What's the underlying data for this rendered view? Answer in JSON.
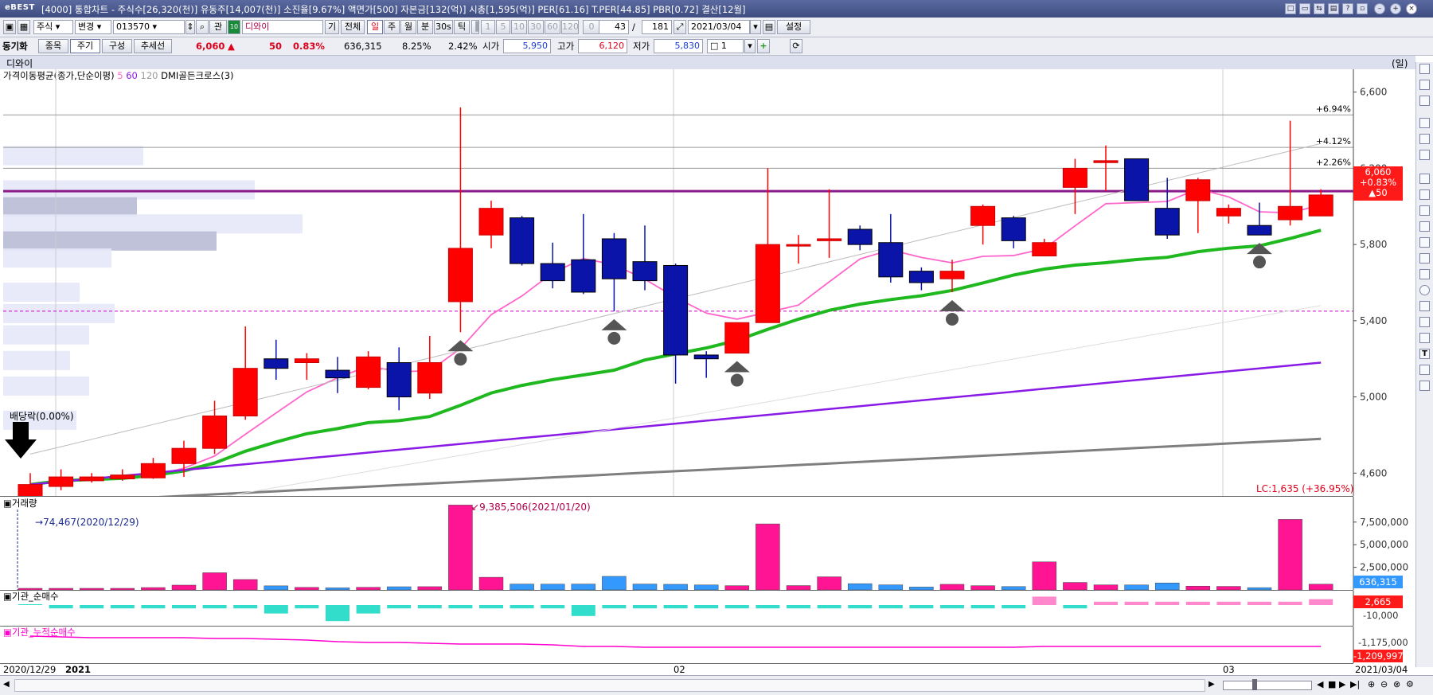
{
  "window": {
    "logo": "eBEST",
    "title": "[4000] 통합차트 - 주식수[26,320(천)] 유동주[14,007(천)] 소진율[9.67%] 액면가[500] 자본금[132(억)] 시총[1,595(억)] PER[61.16] T.PER[44.85] PBR[0.72] 결산[12월]"
  },
  "toolbar1": {
    "market": "주식",
    "change": "변경",
    "code": "013570",
    "related": "관",
    "badge": "10",
    "name": "디와이",
    "gi": "기",
    "all": "전체",
    "periods": [
      "일",
      "주",
      "월",
      "분",
      "30s",
      "틱"
    ],
    "minutes": [
      "1",
      "5",
      "10",
      "30",
      "60",
      "120"
    ],
    "zero": "0",
    "count": "43",
    "slash": "/",
    "total": "181",
    "date": "2021/03/04",
    "settings": "설정"
  },
  "toolbar2": {
    "sync": "동기화",
    "tabs": [
      "종목",
      "주기",
      "구성",
      "추세선"
    ],
    "price": "6,060",
    "arrow": "▲",
    "change": "50",
    "change_pct": "0.83%",
    "volume": "636,315",
    "turnover": "8.25%",
    "ratio": "2.42%",
    "open_label": "시가",
    "open": "5,950",
    "high_label": "고가",
    "high": "6,120",
    "low_label": "저가",
    "low": "5,830",
    "qty": "1"
  },
  "chart": {
    "stock_name": "디와이",
    "unit": "(일)",
    "legend": {
      "ma_label": "가격이동평균(종가,단순이평)",
      "ma5": "5",
      "ma60": "60",
      "ma120": "120",
      "dmi": "DMI골든크로스(3)"
    },
    "dividend_label": "배당락(0.00%)",
    "lc_label": "LC:1,635 (+36.95%)",
    "current_price_tag": {
      "price": "6,060",
      "pct": "+0.83%",
      "chg": "▲50"
    },
    "pct_lines": [
      "+6.94%",
      "+4.12%",
      "+2.26%"
    ],
    "price_ticks": [
      "6,600",
      "6,200",
      "5,800",
      "5,400",
      "5,000",
      "4,600"
    ],
    "volume_title": "거래량",
    "volume_max_label": "9,385,506(2021/01/20)",
    "volume_min_label": "74,467(2020/12/29)",
    "volume_ticks": [
      "7,500,000",
      "5,000,000",
      "2,500,000"
    ],
    "volume_current": "636,315",
    "inst_title": "기관_순매수",
    "inst_ticks": [
      "-10,000"
    ],
    "inst_current": "2,665",
    "inst_cum_title": "기관_누적순매수",
    "inst_cum_ticks": [
      "-1,175,000"
    ],
    "inst_cum_current": "-1,209,997",
    "date_labels": [
      "2020/12/29",
      "2021",
      "02",
      "03",
      "2021/03/04"
    ],
    "colors": {
      "up": "#ff0000",
      "down": "#0a14a8",
      "ma5": "#ff66cc",
      "ma20": "#1fb81f",
      "ma60": "#8a1ae6",
      "ma120": "#7f7f7f",
      "resistance": "#8a1a8a",
      "vol_up": "#ff1493",
      "vol_down": "#3399ff"
    }
  },
  "chart_data": {
    "type": "candlestick",
    "ylim": [
      4480,
      6720
    ],
    "dates": [
      "2020/12/29",
      "2020/12/30",
      "2021/01/04",
      "2021/01/05",
      "2021/01/06",
      "2021/01/07",
      "2021/01/08",
      "2021/01/11",
      "2021/01/12",
      "2021/01/13",
      "2021/01/14",
      "2021/01/15",
      "2021/01/18",
      "2021/01/19",
      "2021/01/20",
      "2021/01/21",
      "2021/01/22",
      "2021/01/25",
      "2021/01/26",
      "2021/01/27",
      "2021/01/28",
      "2021/01/29",
      "2021/02/01",
      "2021/02/02",
      "2021/02/03",
      "2021/02/04",
      "2021/02/05",
      "2021/02/08",
      "2021/02/09",
      "2021/02/10",
      "2021/02/15",
      "2021/02/16",
      "2021/02/17",
      "2021/02/18",
      "2021/02/19",
      "2021/02/22",
      "2021/02/23",
      "2021/02/24",
      "2021/02/25",
      "2021/02/26",
      "2021/03/02",
      "2021/03/03",
      "2021/03/04"
    ],
    "open": [
      4460,
      4530,
      4560,
      4570,
      4575,
      4650,
      4730,
      4900,
      5200,
      5180,
      5140,
      5050,
      5180,
      5020,
      5500,
      5850,
      5940,
      5700,
      5720,
      5830,
      5710,
      5690,
      5220,
      5230,
      5390,
      5800,
      5820,
      5880,
      5810,
      5660,
      5620,
      5900,
      5940,
      5740,
      6100,
      6230,
      6250,
      5990,
      6030,
      5950,
      5900,
      5930,
      5950
    ],
    "close": [
      4540,
      4580,
      4580,
      4590,
      4650,
      4730,
      4900,
      5150,
      5150,
      5200,
      5100,
      5210,
      5000,
      5180,
      5780,
      5990,
      5700,
      5610,
      5550,
      5620,
      5610,
      5220,
      5200,
      5390,
      5800,
      5800,
      5830,
      5800,
      5630,
      5600,
      5660,
      6000,
      5820,
      5810,
      6200,
      6240,
      6030,
      5850,
      6140,
      5990,
      5850,
      6000,
      6060
    ],
    "high": [
      4600,
      4620,
      4600,
      4620,
      4680,
      4770,
      4980,
      5370,
      5300,
      5230,
      5210,
      5240,
      5260,
      5320,
      6520,
      6030,
      5950,
      5810,
      5960,
      5860,
      5900,
      5700,
      5240,
      5370,
      6200,
      5850,
      6090,
      5900,
      5960,
      5680,
      5720,
      6010,
      5950,
      5830,
      6250,
      6320,
      6250,
      6150,
      6150,
      6010,
      6020,
      6450,
      6090
    ],
    "low": [
      4430,
      4510,
      4550,
      4560,
      4570,
      4580,
      4700,
      4880,
      5090,
      5090,
      5020,
      5040,
      4930,
      4990,
      5340,
      5780,
      5690,
      5570,
      5540,
      5450,
      5560,
      5070,
      5100,
      5230,
      5390,
      5700,
      5730,
      5770,
      5600,
      5560,
      5550,
      5800,
      5780,
      5780,
      5960,
      6080,
      6050,
      5830,
      5860,
      5910,
      5850,
      5900,
      5950
    ],
    "volume": [
      74467,
      120000,
      95000,
      110000,
      260000,
      530000,
      1900000,
      1150000,
      450000,
      280000,
      230000,
      290000,
      350000,
      360000,
      9385506,
      1400000,
      650000,
      640000,
      650000,
      1500000,
      650000,
      620000,
      550000,
      470000,
      7300000,
      480000,
      1450000,
      690000,
      560000,
      320000,
      620000,
      470000,
      370000,
      3100000,
      830000,
      560000,
      550000,
      770000,
      420000,
      390000,
      250000,
      7800000,
      636315
    ]
  }
}
